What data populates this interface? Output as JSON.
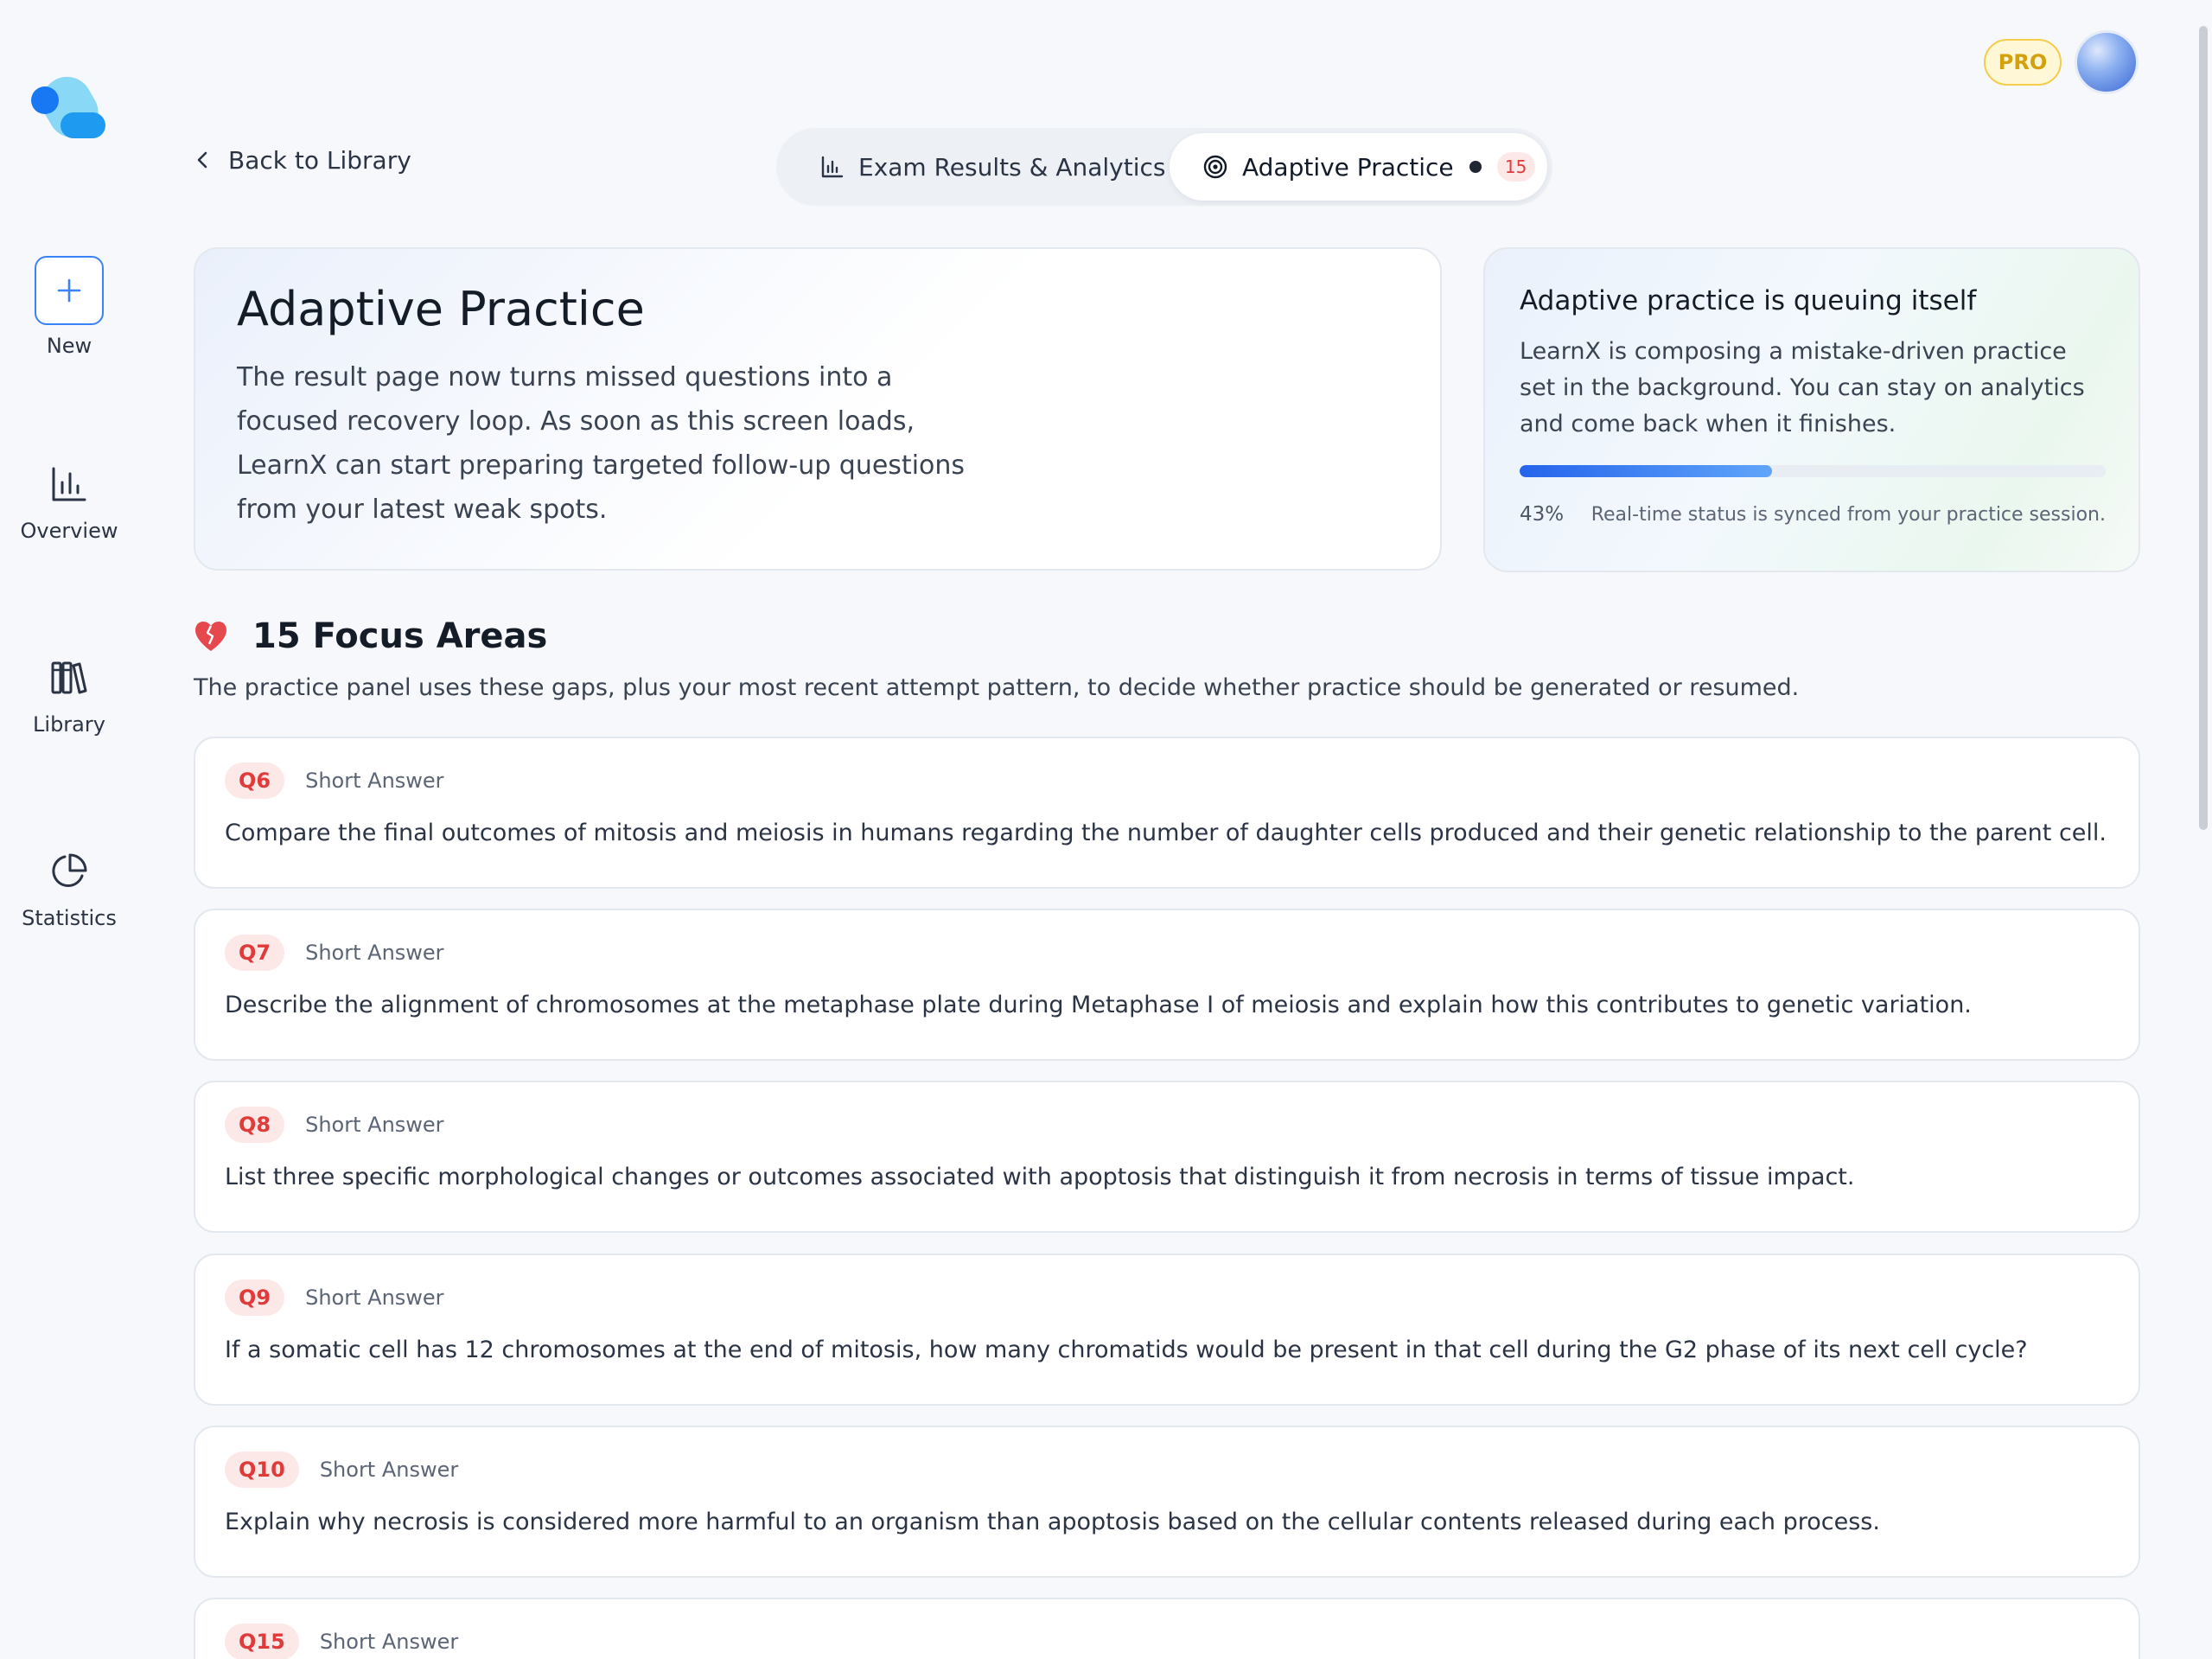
{
  "sidebar": {
    "items": [
      {
        "label": "New",
        "icon": "plus-icon"
      },
      {
        "label": "Overview",
        "icon": "bar-chart-icon"
      },
      {
        "label": "Library",
        "icon": "books-icon"
      },
      {
        "label": "Statistics",
        "icon": "pie-chart-icon"
      }
    ]
  },
  "header": {
    "pro_badge": "PRO",
    "back_label": "Back to Library",
    "tabs": [
      {
        "label": "Exam Results & Analytics",
        "icon": "bar-chart-icon"
      },
      {
        "label": "Adaptive Practice",
        "icon": "target-icon",
        "count": "15"
      }
    ]
  },
  "hero": {
    "title": "Adaptive Practice",
    "body": "The result page now turns missed questions into a focused recovery loop. As soon as this screen loads, LearnX can start preparing targeted follow-up questions from your latest weak spots."
  },
  "status": {
    "title": "Adaptive practice is queuing itself",
    "body": "LearnX is composing a mistake-driven practice set in the background. You can stay on analytics and come back when it finishes.",
    "progress": 0.43,
    "progress_label": "43%",
    "sync_note": "Real-time status is synced from your practice session."
  },
  "focus": {
    "icon": "broken-heart-icon",
    "title": "15 Focus Areas",
    "subtitle": "The practice panel uses these gaps, plus your most recent attempt pattern, to decide whether practice should be generated or resumed."
  },
  "questions": [
    {
      "id": "Q6",
      "type": "Short Answer",
      "text": "Compare the final outcomes of mitosis and meiosis in humans regarding the number of daughter cells produced and their genetic relationship to the parent cell."
    },
    {
      "id": "Q7",
      "type": "Short Answer",
      "text": "Describe the alignment of chromosomes at the metaphase plate during Metaphase I of meiosis and explain how this contributes to genetic variation."
    },
    {
      "id": "Q8",
      "type": "Short Answer",
      "text": "List three specific morphological changes or outcomes associated with apoptosis that distinguish it from necrosis in terms of tissue impact."
    },
    {
      "id": "Q9",
      "type": "Short Answer",
      "text": "If a somatic cell has 12 chromosomes at the end of mitosis, how many chromatids would be present in that cell during the G2 phase of its next cell cycle?"
    },
    {
      "id": "Q10",
      "type": "Short Answer",
      "text": "Explain why necrosis is considered more harmful to an organism than apoptosis based on the cellular contents released during each process."
    },
    {
      "id": "Q15",
      "type": "Short Answer",
      "text": ""
    }
  ],
  "colors": {
    "accent": "#3b82f6",
    "danger": "#e03a3a",
    "pro": "#d4a00c"
  }
}
